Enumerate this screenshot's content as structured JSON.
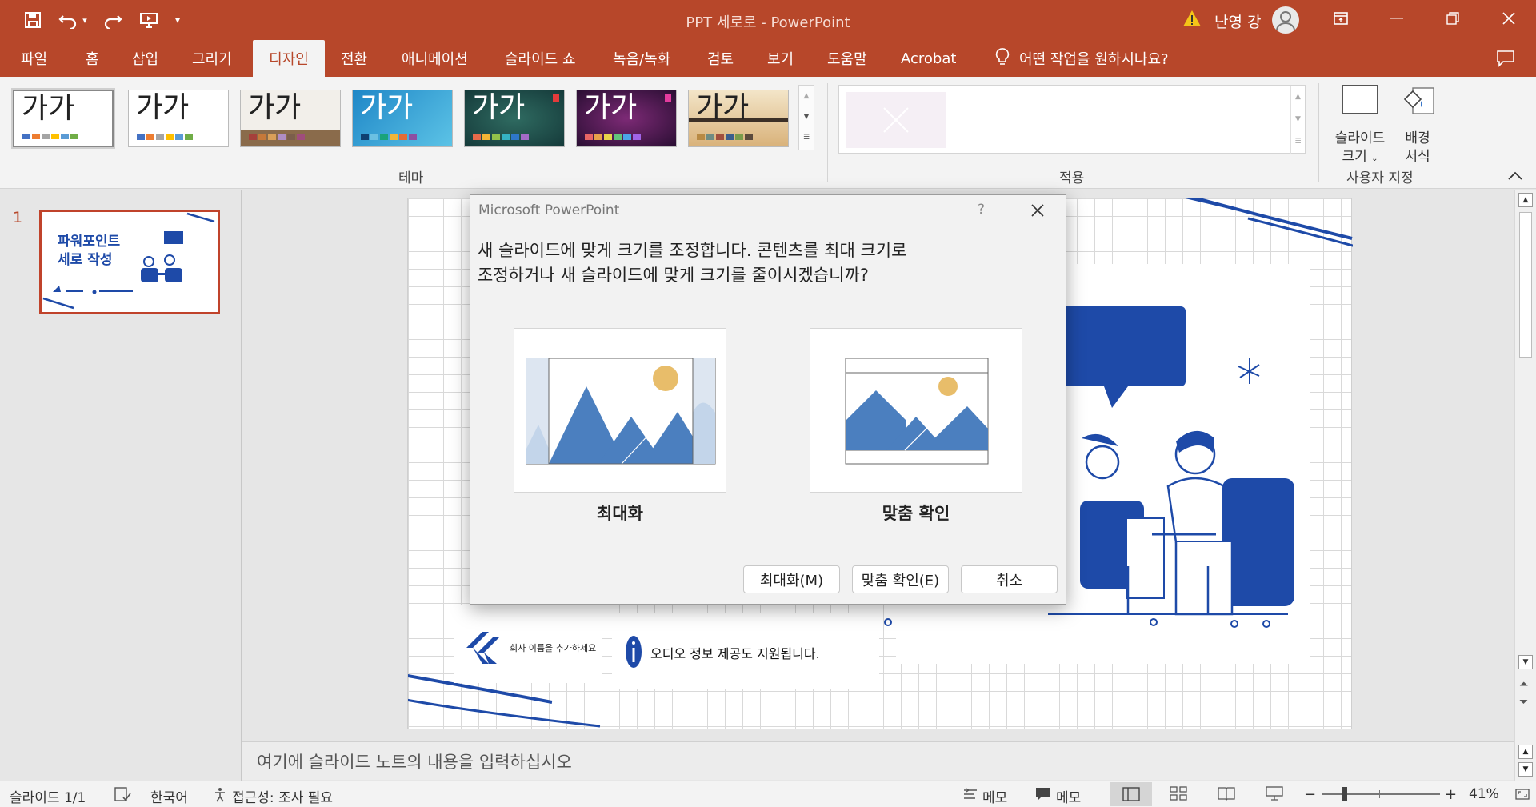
{
  "window": {
    "title": "PPT 세로로  -  PowerPoint",
    "user": "난영 강"
  },
  "tabs": [
    "파일",
    "홈",
    "삽입",
    "그리기",
    "디자인",
    "전환",
    "애니메이션",
    "슬라이드 쇼",
    "녹음/녹화",
    "검토",
    "보기",
    "도움말",
    "Acrobat"
  ],
  "active_tab": "디자인",
  "tell_me": "어떤 작업을 원하시나요?",
  "ribbon": {
    "themes_sample": "가가",
    "group_themes": "테마",
    "group_variants": "적용",
    "slide_size_label1": "슬라이드",
    "slide_size_label2": "크기",
    "bg_format_label1": "배경",
    "bg_format_label2": "서식",
    "group_customize": "사용자 지정"
  },
  "slides_pane": {
    "slide_number": "1",
    "thumb_title1": "파워포인트",
    "thumb_title2": "세로 작성"
  },
  "slide": {
    "company_text": "회사 이름을 추가하세요",
    "audio_text": "오디오 정보 제공도 지원됩니다."
  },
  "notes_placeholder": "여기에 슬라이드 노트의 내용을 입력하십시오",
  "status": {
    "slide_counter": "슬라이드 1/1",
    "language": "한국어",
    "accessibility": "접근성: 조사 필요",
    "notes": "메모",
    "comments": "메모",
    "zoom": "41%"
  },
  "dialog": {
    "title": "Microsoft PowerPoint",
    "help": "?",
    "message": "새 슬라이드에 맞게 크기를 조정합니다. 콘텐츠를 최대 크기로\n조정하거나 새 슬라이드에 맞게 크기를 줄이시겠습니까?",
    "option_maximize": "최대화",
    "option_fit": "맞춤 확인",
    "btn_maximize": "최대화(M)",
    "btn_fit": "맞춤 확인(E)",
    "btn_cancel": "취소"
  },
  "colors": {
    "accent": "#b7472a",
    "illustration_blue": "#1e4aa8",
    "sun": "#e8bd6a"
  }
}
